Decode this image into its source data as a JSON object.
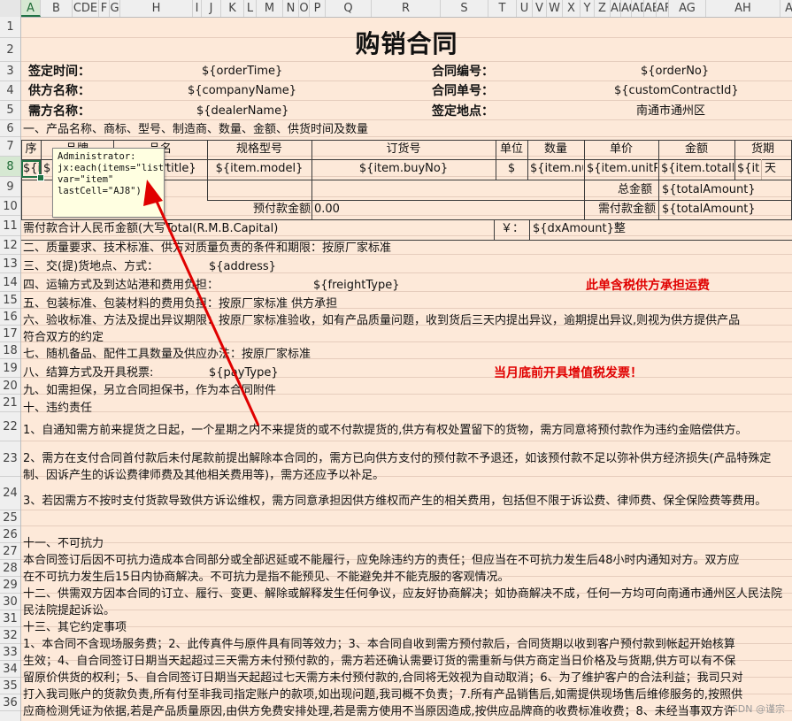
{
  "columns": [
    "A",
    "B",
    "CDE",
    "F",
    "G",
    "H",
    "I",
    "J",
    "K",
    "L",
    "M",
    "N",
    "O",
    "P",
    "Q",
    "R",
    "S",
    "T",
    "U",
    "V",
    "W",
    "X",
    "Y",
    "Z",
    "AB",
    "AC",
    "AD",
    "AE",
    "AF",
    "AG",
    "AH",
    "AI",
    "AJ"
  ],
  "rows": [
    "1",
    "2",
    "3",
    "4",
    "5",
    "6",
    "7",
    "8",
    "9",
    "10",
    "11",
    "12",
    "13",
    "14",
    "15",
    "16",
    "17",
    "18",
    "19",
    "20",
    "21",
    "22",
    "23",
    "24",
    "25",
    "26",
    "27",
    "28",
    "29",
    "30",
    "31",
    "32",
    "33",
    "34",
    "35",
    "36"
  ],
  "selection": {
    "column": "A",
    "row": "8"
  },
  "title": "购销合同",
  "header": {
    "sign_time_label": "签定时间：",
    "sign_time_value": "${orderTime}",
    "contract_no_label": "合同编号：",
    "contract_no_value": "${orderNo}",
    "supplier_label": "供方名称：",
    "supplier_value": "${companyName}",
    "contract_single_label": "合同单号：",
    "contract_single_value": "${customContractId}",
    "demander_label": "需方名称：",
    "demander_value": "${dealerName}",
    "sign_place_label": "签定地点：",
    "sign_place_value": "南通市通州区"
  },
  "section1": "一、产品名称、商标、型号、制造商、数量、金额、供货时间及数量",
  "table": {
    "headers": [
      "序",
      "品牌",
      "品名",
      "规格型号",
      "订货号",
      "单位",
      "数量",
      "单价",
      "金额",
      "货期"
    ],
    "row": [
      "${i",
      "${jx",
      "title}",
      "${item.model}",
      "${item.buyNo}",
      "$",
      "${item.nu",
      "${item.unitPri",
      "${item.totalPr",
      "${it",
      "天"
    ],
    "total_label": "总金额",
    "total_value": "${totalAmount}",
    "prepay_label": "预付款金额",
    "prepay_value": "0.00",
    "need_prepay_label": "需付款金额",
    "need_prepay_value": "${totalAmount}"
  },
  "rmb_total_label": "需付款合计人民币金额(大写Total(R.M.B.Capital)",
  "yen_label": "￥：",
  "dx_amount": "${dxAmount}整",
  "sections": {
    "s2": "二、质量要求、技术标准、供方对质量负责的条件和期限：按原厂家标准",
    "s3_label": "三、交(提)货地点、方式：",
    "s3_value": "${address}",
    "s4_label": "四、运输方式及到达站港和费用负担：",
    "s4_value": "${freightType}",
    "s4_note": "此单含税供方承担运费",
    "s5": "五、包装标准、包装材料的费用负担：按原厂家标准   供方承担",
    "s6": "六、验收标准、方法及提出异议期限：按原厂家标准验收，如有产品质量问题，收到货后三天内提出异议，逾期提出异议,则视为供方提供产品",
    "s6b": "符合双方的约定",
    "s7": "七、随机备品、配件工具数量及供应办法：按原厂家标准",
    "s8_label": "八、结算方式及开具税票:",
    "s8_value": "${payType}",
    "s8_note": "当月底前开具增值税发票！",
    "s9": "九、如需担保，另立合同担保书，作为本合同附件",
    "s10": "十、违约责任",
    "p22": "1、自通知需方前来提货之日起，一个星期之内不来提货的或不付款提货的,供方有权处置留下的货物，需方同意将预付款作为违约金赔偿供方。",
    "p23": "2、需方在支付合同首付款后未付尾款前提出解除本合同的，需方已向供方支付的预付款不予退还，如该预付款不足以弥补供方经济损失(产品特殊定制、因诉产生的诉讼费律师费及其他相关费用等)，需方还应予以补足。",
    "p24": "3、若因需方不按时支付货款导致供方诉讼维权，需方同意承担因供方维权而产生的相关费用，包括但不限于诉讼费、律师费、保全保险费等费用。",
    "s11": "十一、不可抗力",
    "p27": "本合同签订后因不可抗力造成本合同部分或全部迟延或不能履行，应免除违约方的责任；但应当在不可抗力发生后48小时内通知对方。双方应",
    "p28": "在不可抗力发生后15日内协商解决。不可抗力是指不能预见、不能避免并不能克服的客观情况。",
    "p29": "十二、供需双方因本合同的订立、履行、变更、解除或解释发生任何争议，应友好协商解决；如协商解决不成，任何一方均可向南通市通州区人民法院",
    "p30": "民法院提起诉讼。",
    "s13": "十三、其它约定事项",
    "p32": "1、本合同不含现场服务费；2、此传真件与原件具有同等效力；3、本合同自收到需方预付款后，合同货期以收到客户预付款到帐起开始核算",
    "p33": "生效；4、自合同签订日期当天起超过三天需方未付预付款的，需方若还确认需要订货的需重新与供方商定当日价格及与货期,供方可以有不保",
    "p34": "留原价供货的权利；5、自合同签订日期当天起超过七天需方未付预付款的,合同将无效视为自动取消；6、为了维护客户的合法利益；我司只对",
    "p35": "打入我司账户的货款负责,所有付至非我司指定账户的款项,如出现问题,我司概不负责；7.所有产品销售后,如需提供现场售后维修服务的,按照供",
    "p36": "应商检测凭证为依据,若是产品质量原因,由供方免费安排处理,若是需方使用不当原因造成,按供应品牌商的收费标准收费；8、未经当事双方许"
  },
  "comment": {
    "line1": "Administrator:",
    "line2": "jx:each(items=\"list\"",
    "line3": "var=\"item\"",
    "line4": "lastCell=\"AJ8\")"
  },
  "colors": {
    "sheet_bg": "#fde9d9",
    "arrow": "#e00000",
    "selection": "#217346"
  },
  "watermark": "CSDN @谨宗"
}
